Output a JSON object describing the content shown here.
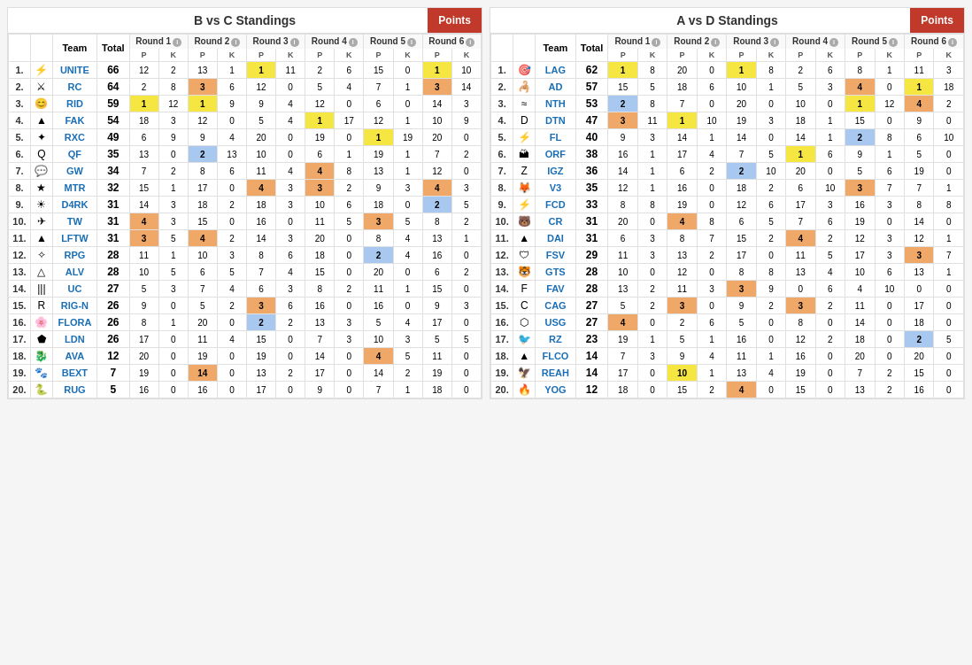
{
  "leftBlock": {
    "title": "B vs C Standings",
    "pointsBtn": "Points",
    "columns": [
      "Team",
      "Total",
      "Round 1",
      "Round 2",
      "Round 3",
      "Round 4",
      "Round 5",
      "Round 6"
    ],
    "rows": [
      {
        "rank": 1,
        "logo": "⚡",
        "team": "UNITE",
        "total": 66,
        "r1p": 12,
        "r1k": 2,
        "r2p": 13,
        "r2k": 1,
        "r3p": 1,
        "r3k": 11,
        "r4p": 2,
        "r4k": 6,
        "r5p": 15,
        "r5k": 0,
        "r6p": 1,
        "r6k": 10,
        "r3p_hl": "yellow",
        "r6p_hl": "yellow"
      },
      {
        "rank": 2,
        "logo": "⚔",
        "team": "RC",
        "total": 64,
        "r1p": 2,
        "r1k": 8,
        "r2p": 3,
        "r2k": 6,
        "r3p": 12,
        "r3k": 0,
        "r4p": 5,
        "r4k": 4,
        "r5p": 7,
        "r5k": 1,
        "r6p": 3,
        "r6k": 14,
        "r2p_hl": "orange",
        "r6p_hl": "orange"
      },
      {
        "rank": 3,
        "logo": "😊",
        "team": "RID",
        "total": 59,
        "r1p": 1,
        "r1k": 12,
        "r2p": 1,
        "r2k": 9,
        "r3p": 9,
        "r3k": 4,
        "r4p": 12,
        "r4k": 0,
        "r5p": 6,
        "r5k": 0,
        "r6p": 14,
        "r6k": 3,
        "r1p_hl": "yellow",
        "r2p_hl": "yellow"
      },
      {
        "rank": 4,
        "logo": "▲",
        "team": "FAK",
        "total": 54,
        "r1p": 18,
        "r1k": 3,
        "r2p": 12,
        "r2k": 0,
        "r3p": 5,
        "r3k": 4,
        "r4p": 1,
        "r4k": 17,
        "r5p": 12,
        "r5k": 1,
        "r6p": 10,
        "r6k": 9,
        "r4p_hl": "yellow"
      },
      {
        "rank": 5,
        "logo": "✦",
        "team": "RXC",
        "total": 49,
        "r1p": 6,
        "r1k": 9,
        "r2p": 9,
        "r2k": 4,
        "r3p": 20,
        "r3k": 0,
        "r4p": 19,
        "r4k": 0,
        "r5p": 1,
        "r5k": 19,
        "r6p": 20,
        "r6k": 0,
        "r5p_hl": "yellow"
      },
      {
        "rank": 6,
        "logo": "Q",
        "team": "QF",
        "total": 35,
        "r1p": 13,
        "r1k": 0,
        "r2p": 2,
        "r2k": 13,
        "r3p": 10,
        "r3k": 0,
        "r4p": 6,
        "r4k": 1,
        "r5p": 19,
        "r5k": 1,
        "r6p": 7,
        "r6k": 2,
        "r2p_hl": "blue"
      },
      {
        "rank": 7,
        "logo": "💬",
        "team": "GW",
        "total": 34,
        "r1p": 7,
        "r1k": 2,
        "r2p": 8,
        "r2k": 6,
        "r3p": 11,
        "r3k": 4,
        "r4p": 4,
        "r4k": 8,
        "r5p": 13,
        "r5k": 1,
        "r6p": 12,
        "r6k": 0,
        "r4p_hl": "orange"
      },
      {
        "rank": 8,
        "logo": "★",
        "team": "MTR",
        "total": 32,
        "r1p": 15,
        "r1k": 1,
        "r2p": 17,
        "r2k": 0,
        "r3p": 4,
        "r3k": 3,
        "r4p": 3,
        "r4k": 2,
        "r5p": 9,
        "r5k": 3,
        "r6p": 4,
        "r6k": 3,
        "r3p_hl": "orange",
        "r4p_hl": "orange",
        "r6p_hl": "orange"
      },
      {
        "rank": 9,
        "logo": "☀",
        "team": "D4RK",
        "total": 31,
        "r1p": 14,
        "r1k": 3,
        "r2p": 18,
        "r2k": 2,
        "r3p": 18,
        "r3k": 3,
        "r4p": 10,
        "r4k": 6,
        "r5p": 18,
        "r5k": 0,
        "r6p": 2,
        "r6k": 5,
        "r6p_hl": "blue"
      },
      {
        "rank": 10,
        "logo": "✈",
        "team": "TW",
        "total": 31,
        "r1p": 4,
        "r1k": 3,
        "r2p": 15,
        "r2k": 0,
        "r3p": 16,
        "r3k": 0,
        "r4p": 11,
        "r4k": 5,
        "r5p": 3,
        "r5k": 5,
        "r6p": 8,
        "r6k": 2,
        "r1p_hl": "orange",
        "r5p_hl": "orange"
      },
      {
        "rank": 11,
        "logo": "▲",
        "team": "LFTW",
        "total": 31,
        "r1p": 3,
        "r1k": 5,
        "r2p": 4,
        "r2k": 2,
        "r3p": 14,
        "r3k": 3,
        "r4p": 20,
        "r4k": 0,
        "r5p": 8,
        "r5k": 4,
        "r6p": 13,
        "r6k": 1,
        "r1p_hl": "orange",
        "r2p_hl": "orange"
      },
      {
        "rank": 12,
        "logo": "✧",
        "team": "RPG",
        "total": 28,
        "r1p": 11,
        "r1k": 1,
        "r2p": 10,
        "r2k": 3,
        "r3p": 8,
        "r3k": 6,
        "r4p": 18,
        "r4k": 0,
        "r5p": 2,
        "r5k": 4,
        "r6p": 16,
        "r6k": 0,
        "r5p_hl": "blue"
      },
      {
        "rank": 13,
        "logo": "△",
        "team": "ALV",
        "total": 28,
        "r1p": 10,
        "r1k": 5,
        "r2p": 6,
        "r2k": 5,
        "r3p": 7,
        "r3k": 4,
        "r4p": 15,
        "r4k": 0,
        "r5p": 20,
        "r5k": 0,
        "r6p": 6,
        "r6k": 2
      },
      {
        "rank": 14,
        "logo": "|||",
        "team": "UC",
        "total": 27,
        "r1p": 5,
        "r1k": 3,
        "r2p": 7,
        "r2k": 4,
        "r3p": 6,
        "r3k": 3,
        "r4p": 8,
        "r4k": 2,
        "r5p": 11,
        "r5k": 1,
        "r6p": 15,
        "r6k": 0
      },
      {
        "rank": 15,
        "logo": "R",
        "team": "RIG-N",
        "total": 26,
        "r1p": 9,
        "r1k": 0,
        "r2p": 5,
        "r2k": 2,
        "r3p": 3,
        "r3k": 6,
        "r4p": 16,
        "r4k": 0,
        "r5p": 16,
        "r5k": 0,
        "r6p": 9,
        "r6k": 3,
        "r3p_hl": "orange"
      },
      {
        "rank": 16,
        "logo": "🌸",
        "team": "FLORA",
        "total": 26,
        "r1p": 8,
        "r1k": 1,
        "r2p": 20,
        "r2k": 0,
        "r3p": 2,
        "r3k": 2,
        "r4p": 13,
        "r4k": 3,
        "r5p": 5,
        "r5k": 4,
        "r6p": 17,
        "r6k": 0,
        "r3p_hl": "blue"
      },
      {
        "rank": 17,
        "logo": "⬟",
        "team": "LDN",
        "total": 26,
        "r1p": 17,
        "r1k": 0,
        "r2p": 11,
        "r2k": 4,
        "r3p": 15,
        "r3k": 0,
        "r4p": 7,
        "r4k": 3,
        "r5p": 10,
        "r5k": 3,
        "r6p": 5,
        "r6k": 5
      },
      {
        "rank": 18,
        "logo": "🐉",
        "team": "AVA",
        "total": 12,
        "r1p": 20,
        "r1k": 0,
        "r2p": 19,
        "r2k": 0,
        "r3p": 19,
        "r3k": 0,
        "r4p": 14,
        "r4k": 0,
        "r5p": 4,
        "r5k": 5,
        "r6p": 11,
        "r6k": 0,
        "r5p_hl": "orange"
      },
      {
        "rank": 19,
        "logo": "🐾",
        "team": "BEXT",
        "total": 7,
        "r1p": 19,
        "r1k": 0,
        "r2p": 14,
        "r2k": 0,
        "r3p": 13,
        "r3k": 2,
        "r4p": 17,
        "r4k": 0,
        "r5p": 14,
        "r5k": 2,
        "r6p": 19,
        "r6k": 0,
        "r2p_hl": "orange"
      },
      {
        "rank": 20,
        "logo": "🐍",
        "team": "RUG",
        "total": 5,
        "r1p": 16,
        "r1k": 0,
        "r2p": 16,
        "r2k": 0,
        "r3p": 17,
        "r3k": 0,
        "r4p": 9,
        "r4k": 0,
        "r5p": 7,
        "r5k": 1,
        "r6p": 18,
        "r6k": 0
      }
    ]
  },
  "rightBlock": {
    "title": "A vs D Standings",
    "pointsBtn": "Points",
    "columns": [
      "Team",
      "Total",
      "Round 1",
      "Round 2",
      "Round 3",
      "Round 4",
      "Round 5",
      "Round 6"
    ],
    "rows": [
      {
        "rank": 1,
        "logo": "🎯",
        "team": "LAG",
        "total": 62,
        "r1p": 1,
        "r1k": 8,
        "r2p": 20,
        "r2k": 0,
        "r3p": 1,
        "r3k": 8,
        "r4p": 2,
        "r4k": 6,
        "r5p": 8,
        "r5k": 1,
        "r6p": 11,
        "r6k": 3,
        "r1p_hl": "yellow",
        "r3p_hl": "yellow"
      },
      {
        "rank": 2,
        "logo": "🦂",
        "team": "AD",
        "total": 57,
        "r1p": 15,
        "r1k": 5,
        "r2p": 18,
        "r2k": 6,
        "r3p": 10,
        "r3k": 1,
        "r4p": 5,
        "r4k": 3,
        "r5p": 4,
        "r5k": 0,
        "r6p": 1,
        "r6k": 18,
        "r5p_hl": "orange",
        "r6p_hl": "yellow"
      },
      {
        "rank": 3,
        "logo": "≈",
        "team": "NTH",
        "total": 53,
        "r1p": 2,
        "r1k": 8,
        "r2p": 7,
        "r2k": 0,
        "r3p": 20,
        "r3k": 0,
        "r4p": 10,
        "r4k": 0,
        "r5p": 1,
        "r5k": 12,
        "r6p": 4,
        "r6k": 2,
        "r1p_hl": "blue",
        "r5p_hl": "yellow",
        "r6p_hl": "orange"
      },
      {
        "rank": 4,
        "logo": "D",
        "team": "DTN",
        "total": 47,
        "r1p": 3,
        "r1k": 11,
        "r2p": 1,
        "r2k": 10,
        "r3p": 19,
        "r3k": 3,
        "r4p": 18,
        "r4k": 1,
        "r5p": 15,
        "r5k": 0,
        "r6p": 9,
        "r6k": 0,
        "r1p_hl": "orange",
        "r2p_hl": "yellow"
      },
      {
        "rank": 5,
        "logo": "⚡",
        "team": "FL",
        "total": 40,
        "r1p": 9,
        "r1k": 3,
        "r2p": 14,
        "r2k": 1,
        "r3p": 14,
        "r3k": 0,
        "r4p": 14,
        "r4k": 1,
        "r5p": 2,
        "r5k": 8,
        "r6p": 6,
        "r6k": 10,
        "r5p_hl": "blue"
      },
      {
        "rank": 6,
        "logo": "🏔",
        "team": "ORF",
        "total": 38,
        "r1p": 16,
        "r1k": 1,
        "r2p": 17,
        "r2k": 4,
        "r3p": 7,
        "r3k": 5,
        "r4p": 1,
        "r4k": 6,
        "r5p": 9,
        "r5k": 1,
        "r6p": 5,
        "r6k": 0,
        "r4p_hl": "yellow"
      },
      {
        "rank": 7,
        "logo": "Z",
        "team": "IGZ",
        "total": 36,
        "r1p": 14,
        "r1k": 1,
        "r2p": 6,
        "r2k": 2,
        "r3p": 2,
        "r3k": 10,
        "r4p": 20,
        "r4k": 0,
        "r5p": 5,
        "r5k": 6,
        "r6p": 19,
        "r6k": 0,
        "r3p_hl": "blue"
      },
      {
        "rank": 8,
        "logo": "🦊",
        "team": "V3",
        "total": 35,
        "r1p": 12,
        "r1k": 1,
        "r2p": 16,
        "r2k": 0,
        "r3p": 18,
        "r3k": 2,
        "r4p": 6,
        "r4k": 10,
        "r5p": 3,
        "r5k": 7,
        "r6p": 7,
        "r6k": 1,
        "r5p_hl": "orange"
      },
      {
        "rank": 9,
        "logo": "⚡",
        "team": "FCD",
        "total": 33,
        "r1p": 8,
        "r1k": 8,
        "r2p": 19,
        "r2k": 0,
        "r3p": 12,
        "r3k": 6,
        "r4p": 17,
        "r4k": 3,
        "r5p": 16,
        "r5k": 3,
        "r6p": 8,
        "r6k": 8
      },
      {
        "rank": 10,
        "logo": "🐻",
        "team": "CR",
        "total": 31,
        "r1p": 20,
        "r1k": 0,
        "r2p": 4,
        "r2k": 8,
        "r3p": 6,
        "r3k": 5,
        "r4p": 7,
        "r4k": 6,
        "r5p": 19,
        "r5k": 0,
        "r6p": 14,
        "r6k": 0,
        "r2p_hl": "orange"
      },
      {
        "rank": 11,
        "logo": "▲",
        "team": "DAI",
        "total": 31,
        "r1p": 6,
        "r1k": 3,
        "r2p": 8,
        "r2k": 7,
        "r3p": 15,
        "r3k": 2,
        "r4p": 4,
        "r4k": 2,
        "r5p": 12,
        "r5k": 3,
        "r6p": 12,
        "r6k": 1,
        "r4p_hl": "orange"
      },
      {
        "rank": 12,
        "logo": "🛡",
        "team": "FSV",
        "total": 29,
        "r1p": 11,
        "r1k": 3,
        "r2p": 13,
        "r2k": 2,
        "r3p": 17,
        "r3k": 0,
        "r4p": 11,
        "r4k": 5,
        "r5p": 17,
        "r5k": 3,
        "r6p": 3,
        "r6k": 7,
        "r6p_hl": "orange"
      },
      {
        "rank": 13,
        "logo": "🐯",
        "team": "GTS",
        "total": 28,
        "r1p": 10,
        "r1k": 0,
        "r2p": 12,
        "r2k": 0,
        "r3p": 8,
        "r3k": 8,
        "r4p": 13,
        "r4k": 4,
        "r5p": 10,
        "r5k": 6,
        "r6p": 13,
        "r6k": 1
      },
      {
        "rank": 14,
        "logo": "F",
        "team": "FAV",
        "total": 28,
        "r1p": 13,
        "r1k": 2,
        "r2p": 11,
        "r2k": 3,
        "r3p": 3,
        "r3k": 9,
        "r4p": 0,
        "r4k": 6,
        "r5p": 4,
        "r5k": 10,
        "r6p": 0,
        "r6k": 0,
        "r3p_hl": "orange"
      },
      {
        "rank": 15,
        "logo": "C",
        "team": "CAG",
        "total": 27,
        "r1p": 5,
        "r1k": 2,
        "r2p": 3,
        "r2k": 0,
        "r3p": 9,
        "r3k": 2,
        "r4p": 3,
        "r4k": 2,
        "r5p": 11,
        "r5k": 0,
        "r6p": 17,
        "r6k": 0,
        "r2p_hl": "orange",
        "r4p_hl": "orange"
      },
      {
        "rank": 16,
        "logo": "⬡",
        "team": "USG",
        "total": 27,
        "r1p": 4,
        "r1k": 0,
        "r2p": 2,
        "r2k": 6,
        "r3p": 5,
        "r3k": 0,
        "r4p": 8,
        "r4k": 0,
        "r5p": 14,
        "r5k": 0,
        "r6p": 18,
        "r6k": 0,
        "r1p_hl": "orange"
      },
      {
        "rank": 17,
        "logo": "🐦",
        "team": "RZ",
        "total": 23,
        "r1p": 19,
        "r1k": 1,
        "r2p": 5,
        "r2k": 1,
        "r3p": 16,
        "r3k": 0,
        "r4p": 12,
        "r4k": 2,
        "r5p": 18,
        "r5k": 0,
        "r6p": 2,
        "r6k": 5,
        "r6p_hl": "blue"
      },
      {
        "rank": 18,
        "logo": "▲",
        "team": "FLCO",
        "total": 14,
        "r1p": 7,
        "r1k": 3,
        "r2p": 9,
        "r2k": 4,
        "r3p": 11,
        "r3k": 1,
        "r4p": 16,
        "r4k": 0,
        "r5p": 20,
        "r5k": 0,
        "r6p": 20,
        "r6k": 0
      },
      {
        "rank": 19,
        "logo": "🦅",
        "team": "REAH",
        "total": 14,
        "r1p": 17,
        "r1k": 0,
        "r2p": 10,
        "r2k": 1,
        "r3p": 13,
        "r3k": 4,
        "r4p": 19,
        "r4k": 0,
        "r5p": 7,
        "r5k": 2,
        "r6p": 15,
        "r6k": 0,
        "r2p_hl": "yellow"
      },
      {
        "rank": 20,
        "logo": "🔥",
        "team": "YOG",
        "total": 12,
        "r1p": 18,
        "r1k": 0,
        "r2p": 15,
        "r2k": 2,
        "r3p": 4,
        "r3k": 0,
        "r4p": 15,
        "r4k": 0,
        "r5p": 13,
        "r5k": 2,
        "r6p": 16,
        "r6k": 0,
        "r3p_hl": "orange"
      }
    ]
  }
}
